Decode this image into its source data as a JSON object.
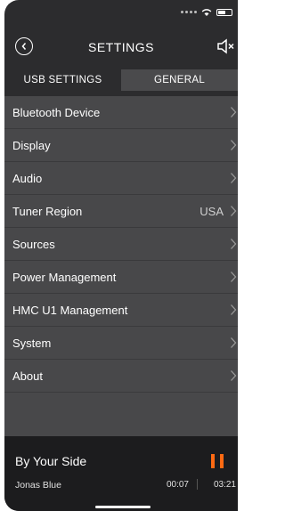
{
  "header": {
    "title": "SETTINGS"
  },
  "tabs": [
    {
      "label": "USB SETTINGS"
    },
    {
      "label": "GENERAL"
    }
  ],
  "settings": [
    {
      "label": "Bluetooth Device"
    },
    {
      "label": "Display"
    },
    {
      "label": "Audio"
    },
    {
      "label": "Tuner Region",
      "value": "USA"
    },
    {
      "label": "Sources"
    },
    {
      "label": "Power Management"
    },
    {
      "label": "HMC U1 Management"
    },
    {
      "label": "System"
    },
    {
      "label": "About"
    }
  ],
  "player": {
    "song": "By Your Side",
    "artist": "Jonas Blue",
    "current_time": "00:07",
    "total_time": "03:21"
  },
  "colors": {
    "accent": "#ff6a13",
    "active_tab": "#4a4a4c",
    "list_bg": "#48484a",
    "background": "#2c2c2e"
  }
}
